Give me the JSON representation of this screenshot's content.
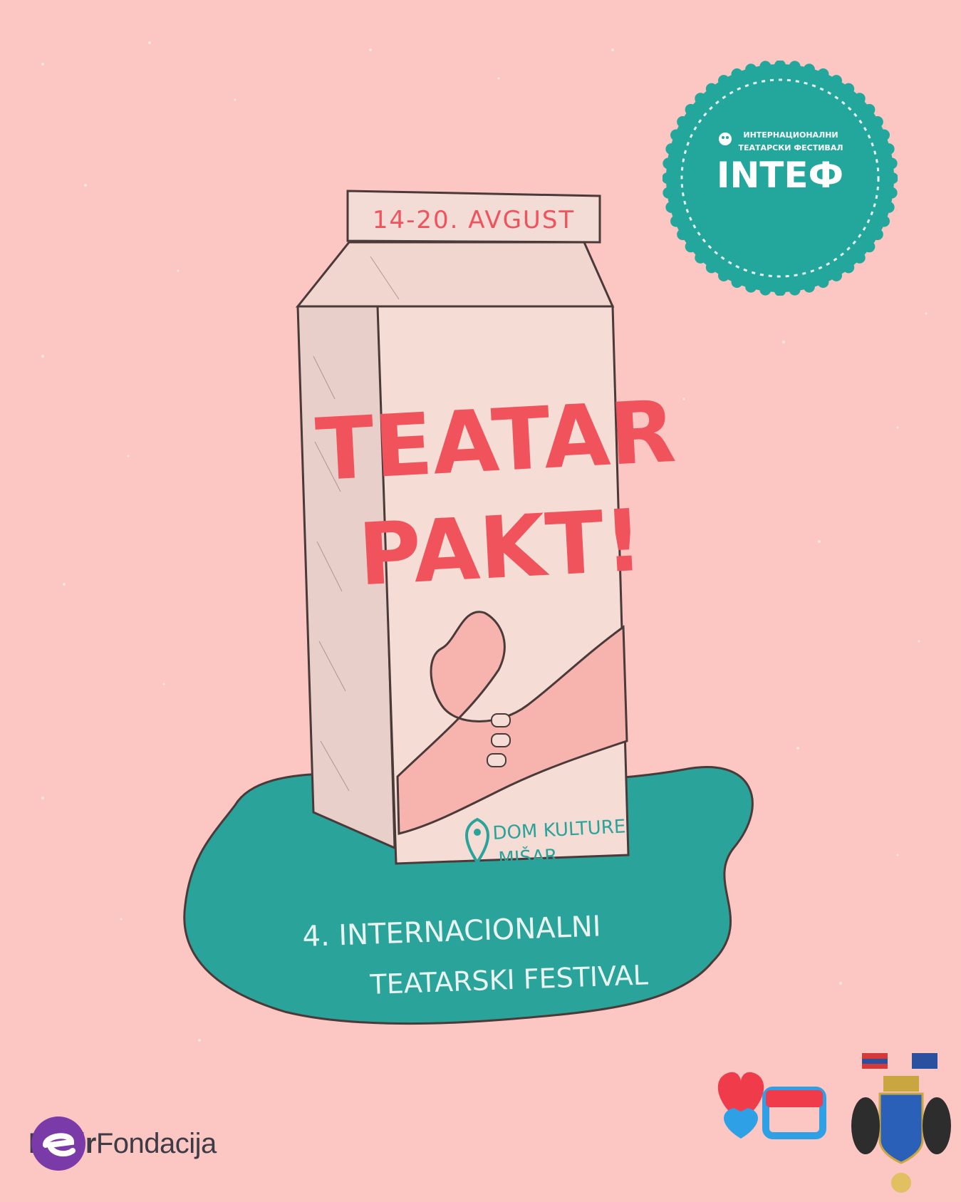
{
  "poster": {
    "dates": "14-20. AVGUST",
    "title_line1": "TEATAR",
    "title_line2": "PAKT!",
    "venue_line1": "DOM KULTURE",
    "venue_line2": "MIŠAR",
    "festival_line1": "4. INTERNACIONALNI",
    "festival_line2": "TEATARSKI FESTIVAL"
  },
  "badge": {
    "line1": "ИНТЕРНАЦИОНАЛНИ",
    "line2": "ТЕАТАРСКИ ФЕСТИВАЛ",
    "wordmark": "INTEФ"
  },
  "sponsor": {
    "name_bold": "Elixir",
    "name_light": "Fondacija"
  },
  "colors": {
    "background": "#fcc6c2",
    "title_red": "#f0535c",
    "teal": "#2aa39a",
    "carton": "#f5dcd5",
    "outline": "#4a3a3a"
  }
}
